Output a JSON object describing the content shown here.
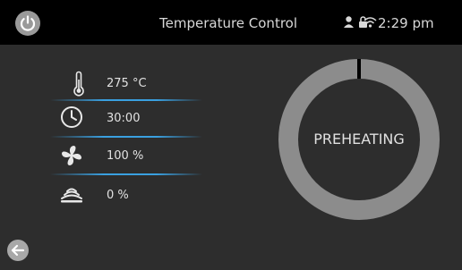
{
  "header": {
    "title": "Temperature Control",
    "time": "2:29 pm",
    "power_icon": "power-icon",
    "status_icons": [
      "person-icon",
      "lock-icon",
      "wifi-icon"
    ]
  },
  "settings": [
    {
      "icon": "thermometer-icon",
      "value": "275 °C"
    },
    {
      "icon": "clock-icon",
      "value": "30:00"
    },
    {
      "icon": "fan-icon",
      "value": "100 %"
    },
    {
      "icon": "steam-icon",
      "value": "0 %"
    }
  ],
  "progress": {
    "status": "PREHEATING",
    "fraction": 0
  },
  "footer": {
    "back_icon": "back-arrow-icon"
  },
  "colors": {
    "background": "#2d2d2d",
    "topbar": "#000000",
    "ring_track": "#8c8c8c",
    "ring_marker": "#000000",
    "divider_accent": "#3aa0e0"
  }
}
